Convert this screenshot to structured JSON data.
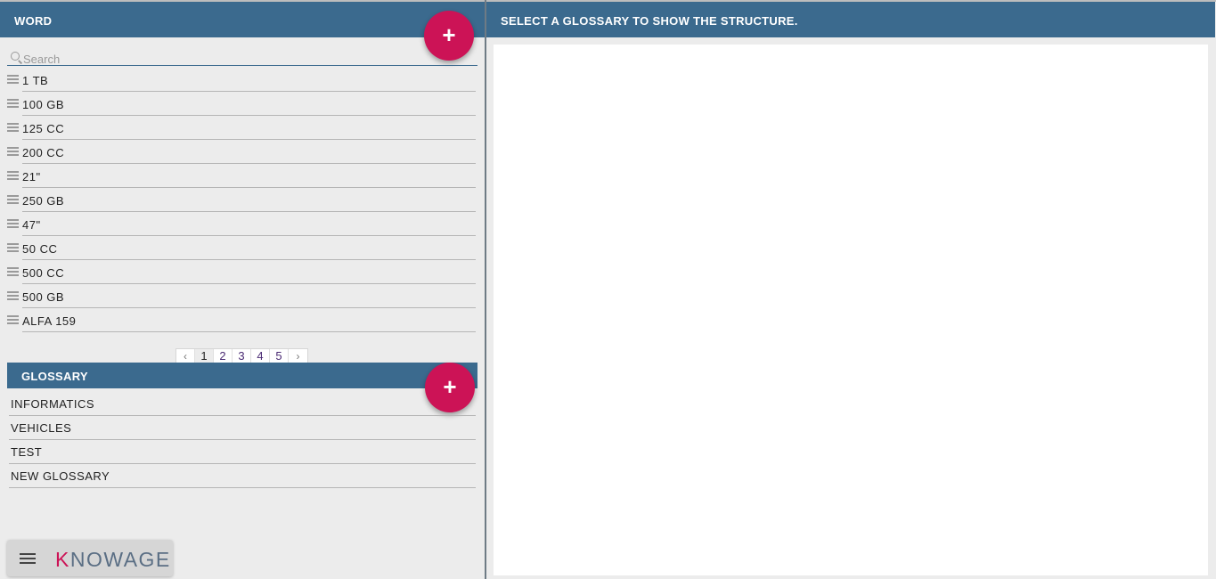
{
  "word_panel": {
    "title": "WORD",
    "add_label": "+",
    "search_placeholder": "Search",
    "items": [
      "1 TB",
      "100 GB",
      "125 CC",
      "200 CC",
      "21\"",
      "250 GB",
      "47\"",
      "50 CC",
      "500 CC",
      "500 GB",
      "ALFA 159"
    ],
    "pagination": {
      "prev": "‹",
      "pages": [
        "1",
        "2",
        "3",
        "4",
        "5"
      ],
      "next": "›",
      "current": "1"
    }
  },
  "glossary_panel": {
    "title": "GLOSSARY",
    "add_label": "+",
    "items": [
      "INFORMATICS",
      "VEHICLES",
      "TEST",
      "NEW GLOSSARY"
    ]
  },
  "structure_panel": {
    "title": "SELECT A GLOSSARY TO SHOW THE STRUCTURE."
  },
  "brand": {
    "logo_k": "K",
    "logo_rest": "NOWAGE",
    "menu_icon": "hamburger-icon"
  },
  "colors": {
    "header": "#3b6a8e",
    "accent": "#cc1356",
    "background": "#ececec"
  }
}
